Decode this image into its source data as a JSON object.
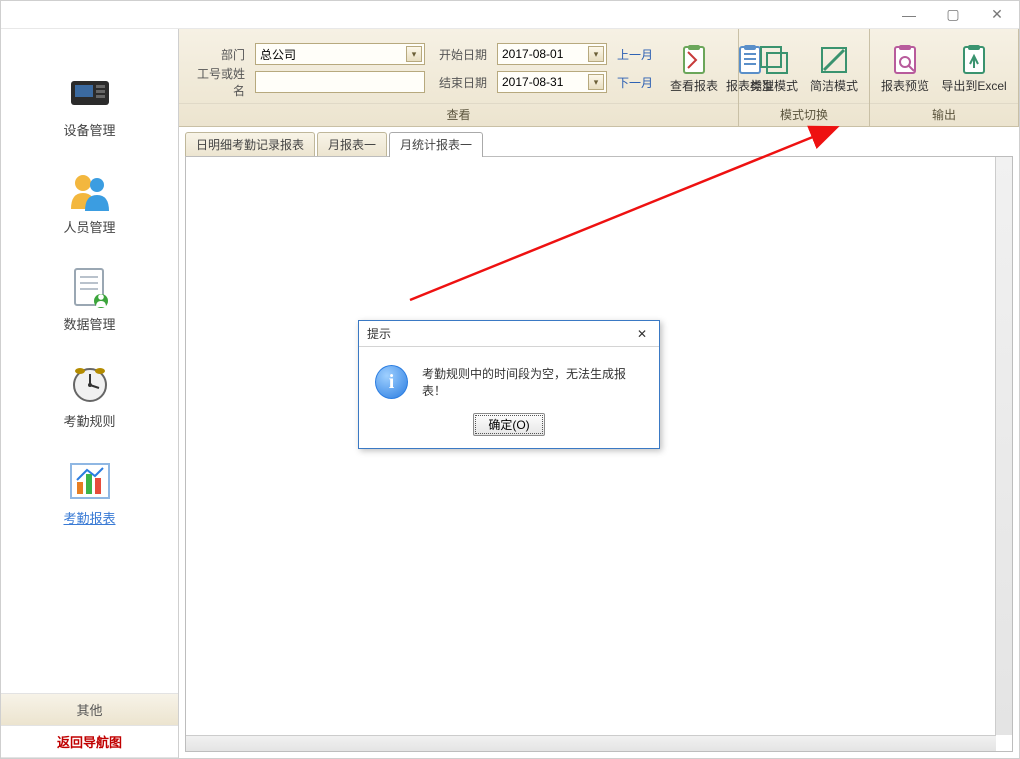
{
  "window": {
    "min": "—",
    "max": "▢",
    "close": "✕"
  },
  "sidebar": {
    "items": [
      {
        "label": "设备管理"
      },
      {
        "label": "人员管理"
      },
      {
        "label": "数据管理"
      },
      {
        "label": "考勤规则"
      },
      {
        "label": "考勤报表"
      }
    ],
    "other": "其他",
    "return_nav": "返回导航图"
  },
  "filters": {
    "dept_label": "部门",
    "dept_value": "总公司",
    "idname_label": "工号或姓名",
    "idname_value": "",
    "start_label": "开始日期",
    "start_value": "2017-08-01",
    "end_label": "结束日期",
    "end_value": "2017-08-31",
    "prev_month": "上一月",
    "next_month": "下一月"
  },
  "ribbon": {
    "view_caption": "查看",
    "view_buttons": [
      {
        "label": "查看报表"
      },
      {
        "label": "报表类型"
      }
    ],
    "mode_caption": "模式切换",
    "mode_buttons": [
      {
        "label": "标准模式"
      },
      {
        "label": "简洁模式"
      }
    ],
    "output_caption": "输出",
    "output_buttons": [
      {
        "label": "报表预览"
      },
      {
        "label": "导出到Excel"
      }
    ]
  },
  "tabs": [
    {
      "label": "日明细考勤记录报表",
      "active": false
    },
    {
      "label": "月报表一",
      "active": false
    },
    {
      "label": "月统计报表一",
      "active": true
    }
  ],
  "dialog": {
    "title": "提示",
    "message": "考勤规则中的时间段为空，无法生成报表！",
    "ok_label": "确定(O)"
  }
}
